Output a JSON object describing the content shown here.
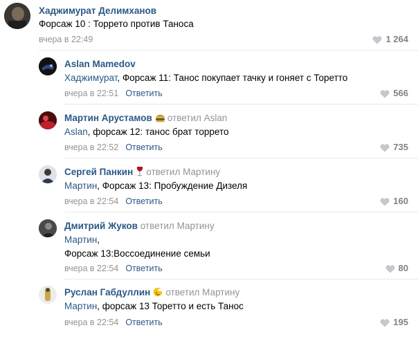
{
  "reply_label": "Ответить",
  "comments": [
    {
      "author": "Хаджимурат Делимханов",
      "replied_label": "",
      "replied_to": "",
      "addressee": "",
      "text_lines": [
        "Форсаж 10 : Торрето против Таноса"
      ],
      "date": "вчера в 22:49",
      "likes": "1 264"
    },
    {
      "author": "Aslan Mamedov",
      "replied_label": "",
      "replied_to": "",
      "addressee": "Хаджимурат",
      "text_lines": [
        ", Форсаж 11: Танос покупает тачку и гоняет с Торетто"
      ],
      "date": "вчера в 22:51",
      "likes": "566"
    },
    {
      "author": "Мартин Арустамов",
      "replied_label": "ответил",
      "replied_to": "Aslan",
      "addressee": "Aslan",
      "text_lines": [
        ", форсаж 12: танос брат торрето"
      ],
      "date": "вчера в 22:52",
      "likes": "735",
      "badge_icon": "burger-icon"
    },
    {
      "author": "Сергей Панкин",
      "replied_label": "ответил",
      "replied_to": "Мартину",
      "addressee": "Мартин",
      "text_lines": [
        ", Форсаж 13: Пробуждение Дизеля"
      ],
      "date": "вчера в 22:54",
      "likes": "160",
      "badge_icon": "wine-glass-icon"
    },
    {
      "author": "Дмитрий Жуков",
      "replied_label": "ответил",
      "replied_to": "Мартину",
      "addressee": "Мартин",
      "text_lines": [
        ",",
        "Форсаж 13:Воссоединение семьи"
      ],
      "date": "вчера в 22:54",
      "likes": "80"
    },
    {
      "author": "Руслан Габдуллин",
      "replied_label": "ответил",
      "replied_to": "Мартину",
      "addressee": "Мартин",
      "text_lines": [
        ", форсаж 13 Торетто и есть Танос"
      ],
      "date": "вчера в 22:54",
      "likes": "195",
      "badge_icon": "emoji-face-icon"
    }
  ],
  "colors": {
    "link": "#2a5885",
    "muted": "#939393",
    "likes": "#828282",
    "divider": "#e7e8ec"
  }
}
